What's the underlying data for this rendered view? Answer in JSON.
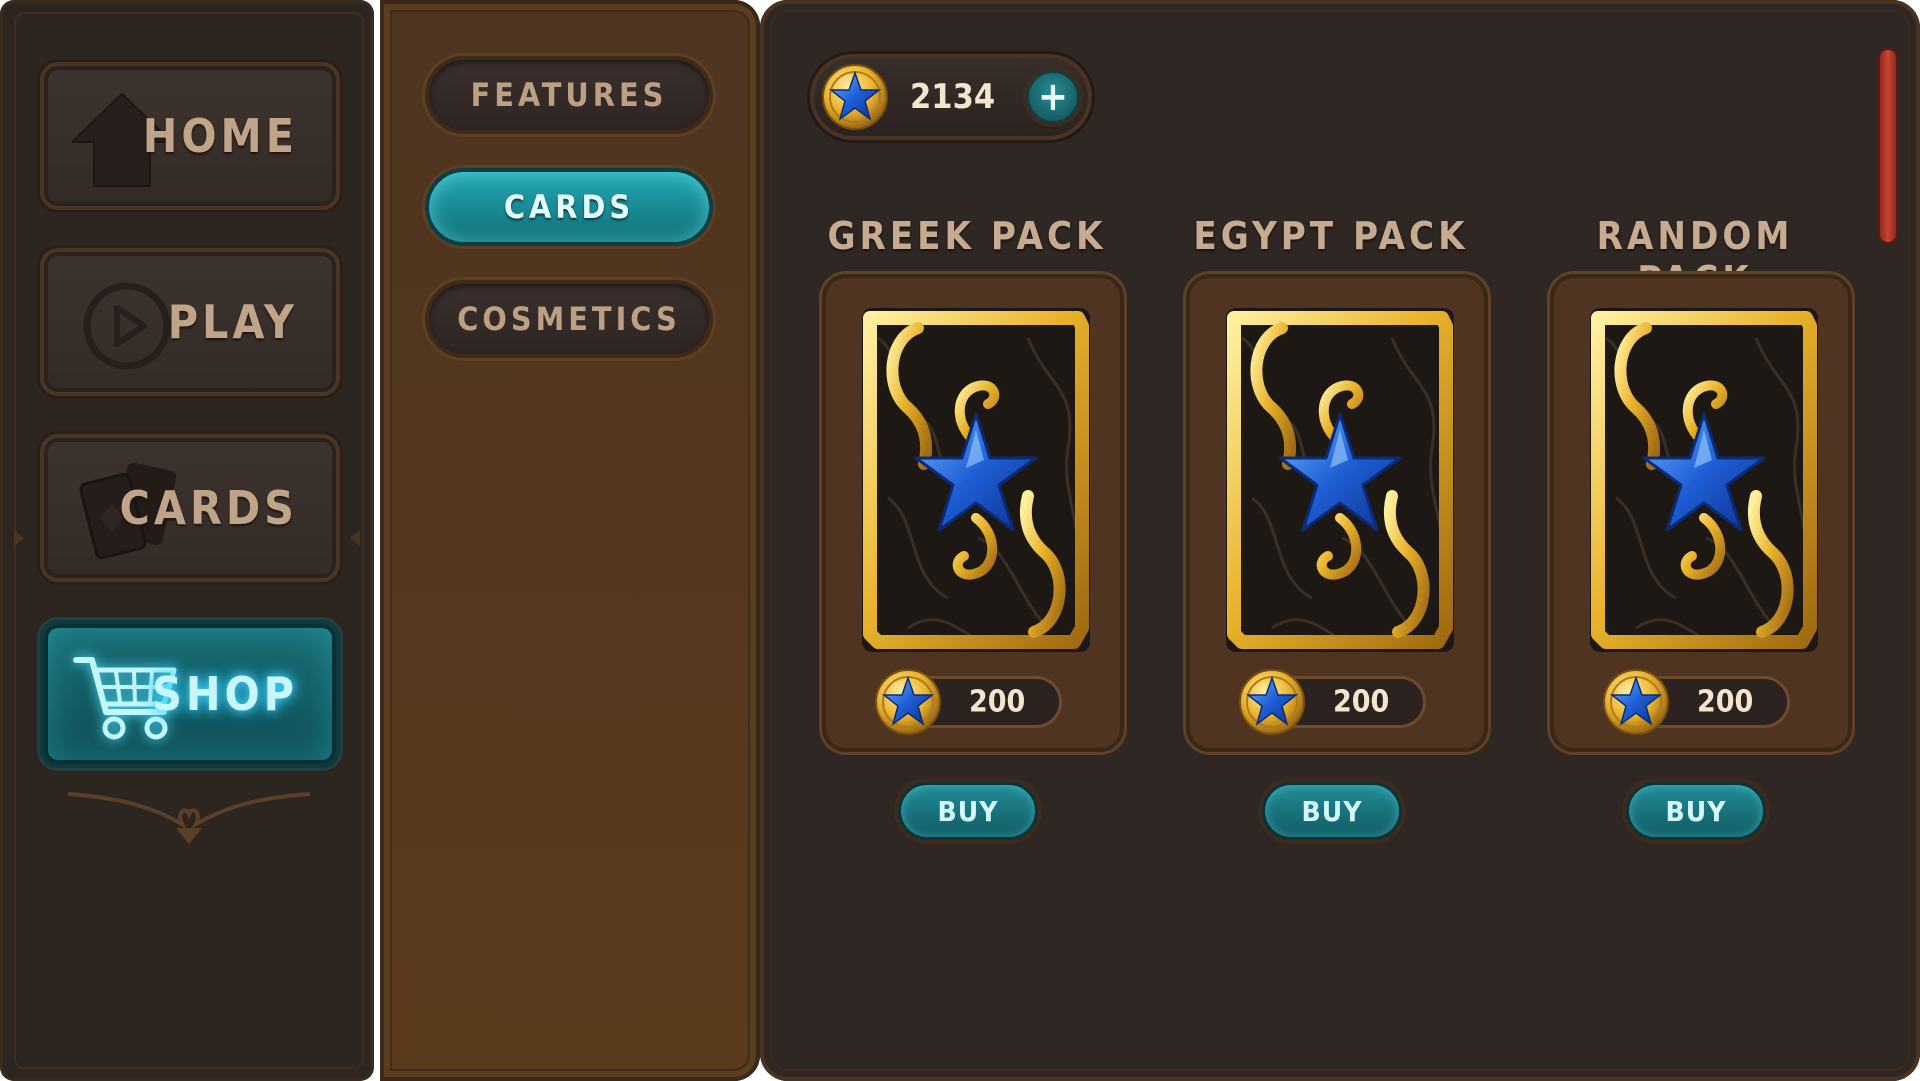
{
  "nav": {
    "items": [
      {
        "label": "HOME",
        "icon": "home-icon",
        "active": false
      },
      {
        "label": "PLAY",
        "icon": "play-icon",
        "active": false
      },
      {
        "label": "CARDS",
        "icon": "cards-icon",
        "active": false
      },
      {
        "label": "SHOP",
        "icon": "cart-icon",
        "active": true
      }
    ]
  },
  "categories": [
    {
      "label": "FEATURES",
      "active": false
    },
    {
      "label": "CARDS",
      "active": true
    },
    {
      "label": "COSMETICS",
      "active": false
    }
  ],
  "wallet": {
    "amount": "2134",
    "plus_label": "+",
    "icon": "star-coin-icon"
  },
  "packs": [
    {
      "title": "GREEK PACK",
      "price": "200",
      "buy_label": "BUY"
    },
    {
      "title": "EGYPT PACK",
      "price": "200",
      "buy_label": "BUY"
    },
    {
      "title": "RANDOM PACK",
      "price": "200",
      "buy_label": "BUY"
    }
  ],
  "colors": {
    "accent_teal": "#1a8f99",
    "gold": "#e9b32c",
    "star_blue": "#1f5fd6",
    "scrollbar_red": "#c8432f"
  }
}
